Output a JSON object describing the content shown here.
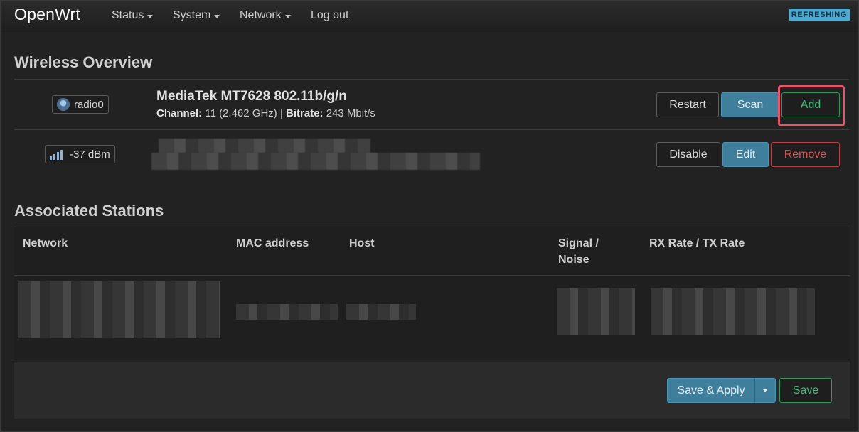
{
  "brand": "OpenWrt",
  "nav": {
    "status": "Status",
    "system": "System",
    "network": "Network",
    "logout": "Log out"
  },
  "refresh_badge": "REFRESHING",
  "wireless": {
    "heading": "Wireless Overview",
    "device": {
      "name": "radio0",
      "title": "MediaTek MT7628 802.11b/g/n",
      "channel_label": "Channel:",
      "channel_value": "11 (2.462 GHz)",
      "separator": "|",
      "bitrate_label": "Bitrate:",
      "bitrate_value": "243 Mbit/s",
      "buttons": {
        "restart": "Restart",
        "scan": "Scan",
        "add": "Add"
      }
    },
    "interface": {
      "signal": "-37 dBm",
      "buttons": {
        "disable": "Disable",
        "edit": "Edit",
        "remove": "Remove"
      }
    }
  },
  "stations": {
    "heading": "Associated Stations",
    "columns": [
      "Network",
      "MAC address",
      "Host",
      "Signal /",
      "Noise",
      "RX Rate / TX Rate"
    ]
  },
  "footer": {
    "save_apply": "Save & Apply",
    "save": "Save"
  },
  "colors": {
    "accent_blue": "#3f7f9c",
    "accent_green": "#3fc27b",
    "danger_red": "#d95757",
    "highlight": "#e85566"
  }
}
